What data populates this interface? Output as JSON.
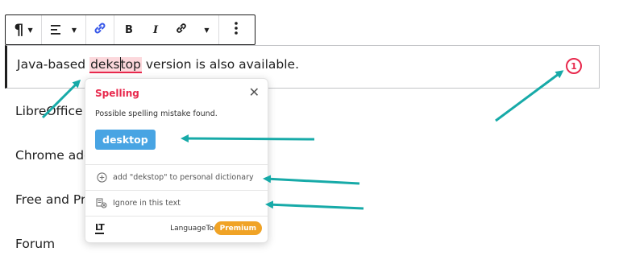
{
  "toolbar": {
    "paragraph_icon": "paragraph-icon",
    "align_icon": "align-left-icon",
    "link_icon": "link-icon",
    "bold_label": "B",
    "italic_label": "I",
    "link2_icon": "link-icon",
    "more_icon": "more-vertical-icon",
    "active_color": "#3858e9"
  },
  "editor": {
    "text_before": "Java-based ",
    "misspelled_part1": "deks",
    "misspelled_part2": "top",
    "text_after": " version is also available.",
    "error_count": "1"
  },
  "paragraphs": [
    "LibreOffice a",
    "Chrome add",
    "Free and Pre",
    "Forum"
  ],
  "popup": {
    "title": "Spelling",
    "message": "Possible spelling mistake found.",
    "suggestion": "desktop",
    "add_to_dictionary": "add \"dekstop\" to personal dictionary",
    "ignore": "Ignore in this text",
    "logo_text": "LT",
    "brand": "LanguageTool",
    "premium": "Premium"
  },
  "colors": {
    "error": "#e8294d",
    "error_highlight": "#fcd8dc",
    "suggestion_bg": "#48a4e3",
    "premium_bg": "#f0a326",
    "annotation_arrow": "#17aaa8"
  }
}
